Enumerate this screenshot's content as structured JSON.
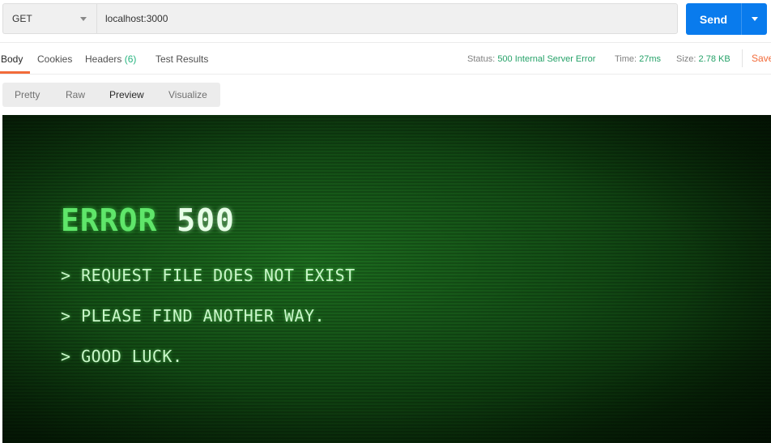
{
  "request": {
    "method": "GET",
    "url": "localhost:3000",
    "send_label": "Send"
  },
  "response_tabs": [
    {
      "label": "Body",
      "active": true
    },
    {
      "label": "Cookies"
    },
    {
      "label": "Headers",
      "count": "(6)"
    },
    {
      "label": "Test Results"
    }
  ],
  "status": {
    "status_label": "Status:",
    "status_value": "500 Internal Server Error",
    "time_label": "Time:",
    "time_value": "27ms",
    "size_label": "Size:",
    "size_value": "2.78 KB",
    "save_label": "Save"
  },
  "view_modes": [
    "Pretty",
    "Raw",
    "Preview",
    "Visualize"
  ],
  "selected_view": "Preview",
  "preview": {
    "title_word": "ERROR",
    "title_code": "500",
    "lines": [
      "> REQUEST FILE DOES NOT EXIST",
      "> PLEASE FIND ANOTHER WAY.",
      "> GOOD LUCK."
    ]
  },
  "colors": {
    "send_button": "#097bed",
    "active_tab_underline": "#f26b3a",
    "status_value": "#26a269",
    "save": "#f26b3a",
    "terminal_green": "#5fe66a"
  },
  "icons": {
    "method_dropdown": "caret-down-icon",
    "send_dropdown": "caret-down-icon"
  }
}
